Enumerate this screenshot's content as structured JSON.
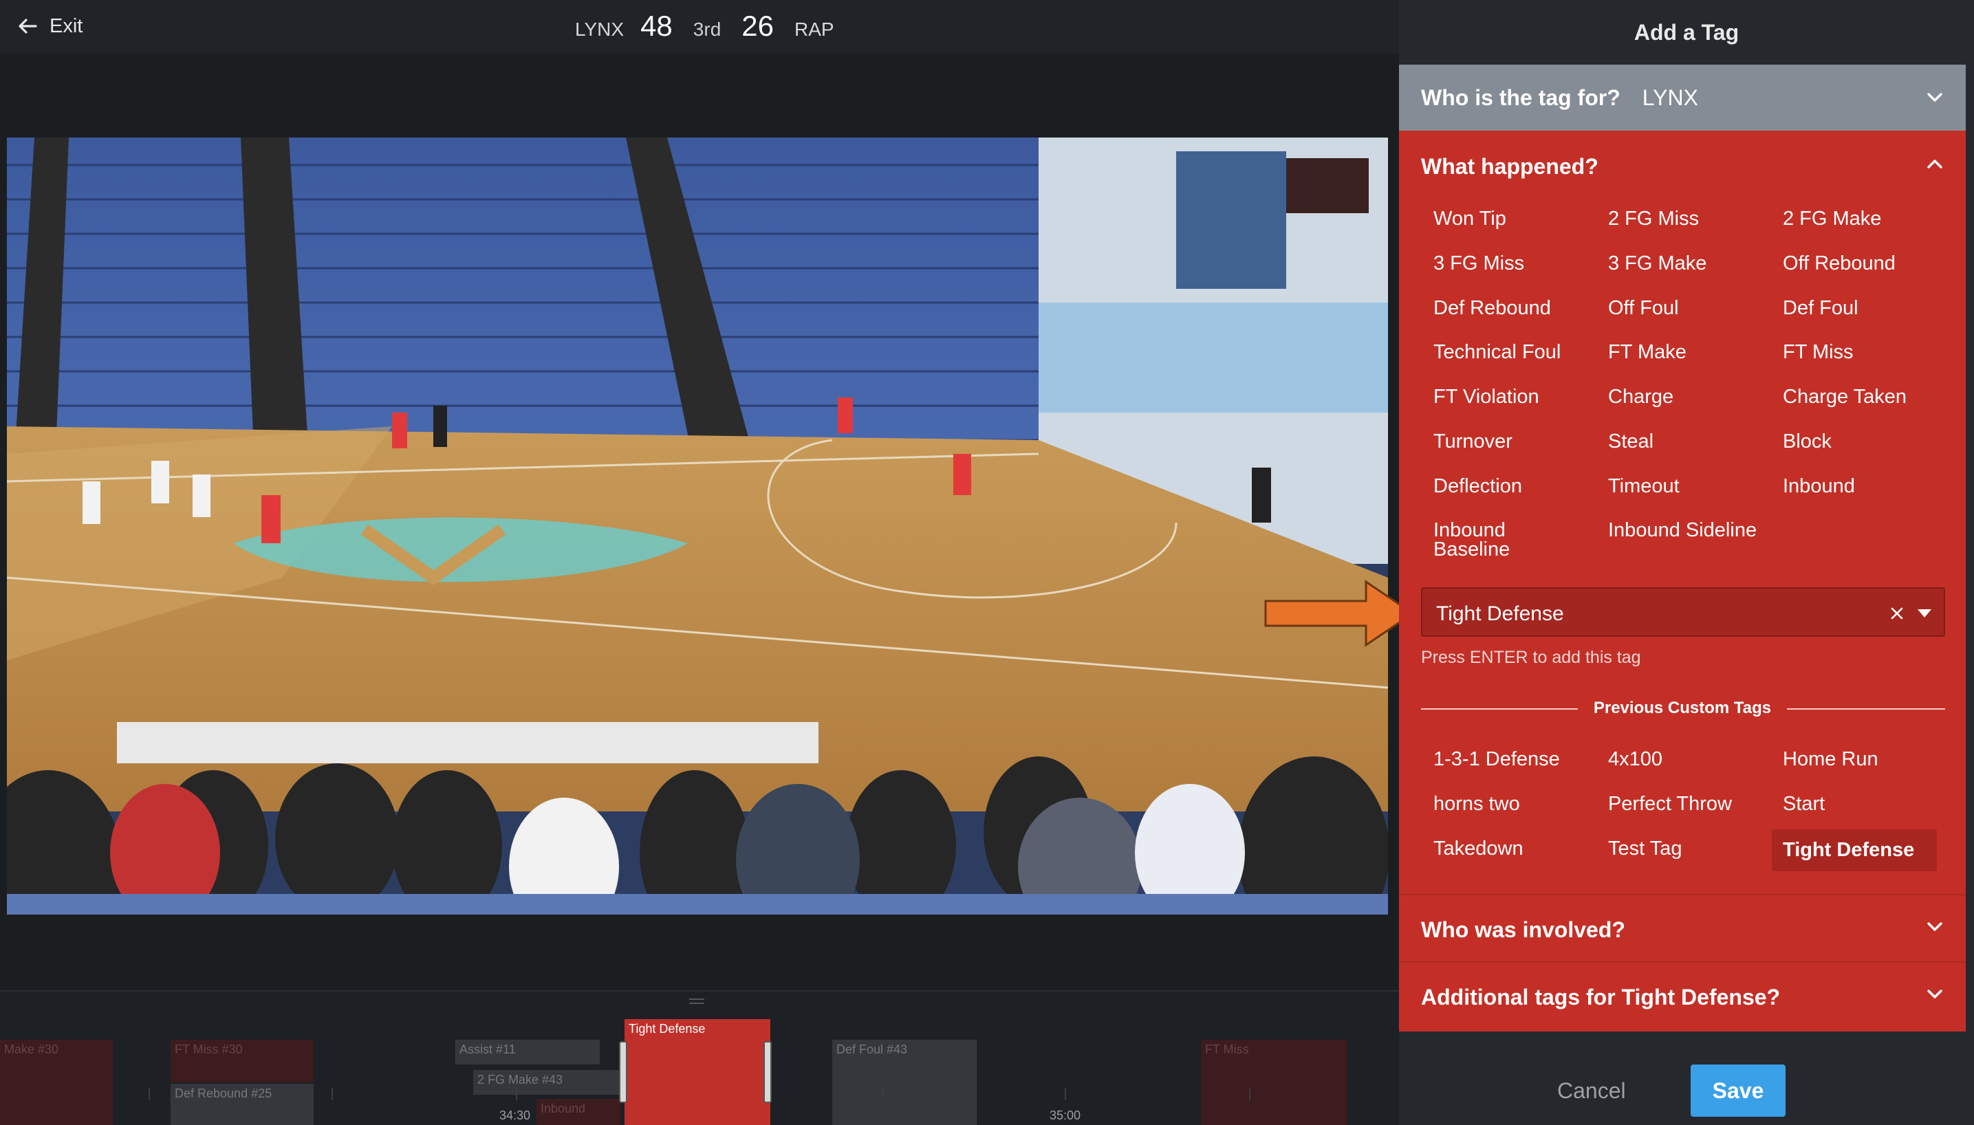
{
  "header": {
    "exit_label": "Exit",
    "home_team": "LYNX",
    "home_score": "48",
    "period": "3rd",
    "away_score": "26",
    "away_team": "RAP"
  },
  "panel": {
    "title": "Add a Tag",
    "who_question": "Who is the tag for?",
    "who_value": "LYNX",
    "what_question": "What happened?",
    "options": [
      [
        "Won Tip",
        "2 FG Miss",
        "2 FG Make"
      ],
      [
        "3 FG Miss",
        "3 FG Make",
        "Off Rebound"
      ],
      [
        "Def Rebound",
        "Off Foul",
        "Def Foul"
      ],
      [
        "Technical Foul",
        "FT Make",
        "FT Miss"
      ],
      [
        "FT Violation",
        "Charge",
        "Charge Taken"
      ],
      [
        "Turnover",
        "Steal",
        "Block"
      ],
      [
        "Deflection",
        "Timeout",
        "Inbound"
      ],
      [
        "Inbound Baseline",
        "Inbound Sideline"
      ]
    ],
    "custom_input_value": "Tight Defense",
    "hint": "Press ENTER to add this tag",
    "previous_label": "Previous Custom Tags",
    "previous_tags": [
      [
        "1-3-1 Defense",
        "4x100",
        "Home Run"
      ],
      [
        "horns two",
        "Perfect Throw",
        "Start"
      ],
      [
        "Takedown",
        "Test Tag",
        "Tight Defense"
      ]
    ],
    "involved_question": "Who was involved?",
    "additional_question": "Additional tags for Tight Defense?",
    "cancel_label": "Cancel",
    "save_label": "Save"
  },
  "timeline": {
    "clips": {
      "c1": "Make #30",
      "c2": "FT Miss #30",
      "c3": "Def Rebound #25",
      "c4": "Assist #11",
      "c5": "2 FG Make #43",
      "c6": "Inbound",
      "c7": "Tight Defense",
      "c8": "Def Foul #43",
      "c9": "FT Miss"
    },
    "time1": "34:30",
    "time2": "35:00"
  },
  "colors": {
    "panel_red": "#c32f27",
    "save_blue": "#3aa0e8",
    "who_gray": "#848c95",
    "arrow_orange": "#e8742a"
  }
}
